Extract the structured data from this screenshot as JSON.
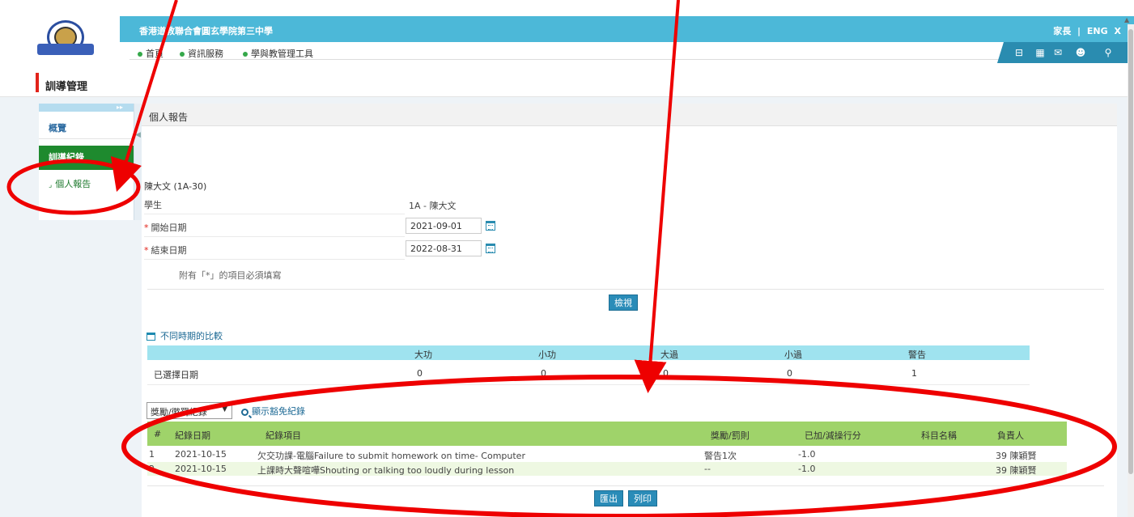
{
  "header": {
    "school_name": "香港道教聯合會圓玄學院第三中學",
    "user_role": "家長",
    "separator": "|",
    "lang_toggle": "ENG",
    "close_label": "X"
  },
  "nav": {
    "items": [
      {
        "label": "首頁"
      },
      {
        "label": "資訊服務"
      },
      {
        "label": "學與教管理工具"
      }
    ]
  },
  "toolbar_icons": [
    "eclass-icon",
    "calendar-icon",
    "mail-icon",
    "group-icon",
    "search-user-icon"
  ],
  "page": {
    "title": "訓導管理"
  },
  "sidebar": {
    "items": [
      {
        "label": "概覽"
      },
      {
        "label": "訓導紀錄"
      },
      {
        "label": "個人報告"
      }
    ]
  },
  "panel": {
    "title": "個人報告"
  },
  "form": {
    "student_heading": "陳大文 (1A-30)",
    "student_label": "學生",
    "student_value": "1A - 陳大文",
    "start_label": "開始日期",
    "start_value": "2021-09-01",
    "end_label": "結束日期",
    "end_value": "2022-08-31",
    "required_star": "*",
    "required_note": "附有「*」的項目必須填寫",
    "view_button": "檢視"
  },
  "comparison": {
    "title": "不同時期的比較",
    "columns": [
      "大功",
      "小功",
      "大過",
      "小過",
      "警告"
    ],
    "row_label": "已選擇日期",
    "values": [
      "0",
      "0",
      "0",
      "0",
      "1"
    ]
  },
  "records": {
    "filter_value": "獎勵/懲罰紀錄",
    "show_exempt": "顯示豁免紀錄",
    "columns": {
      "index": "#",
      "date": "紀錄日期",
      "item": "紀錄項目",
      "merit": "獎勵/罰則",
      "score": "已加/減操行分",
      "subject": "科目名稱",
      "teacher": "負責人"
    },
    "rows": [
      {
        "index": "1",
        "date": "2021-10-15",
        "item": "欠交功課-電腦Failure to submit homework on time- Computer",
        "merit": "警告1次",
        "score": "-1.0",
        "subject": "",
        "teacher": "39 陳穎賢"
      },
      {
        "index": "2",
        "date": "2021-10-15",
        "item": "上課時大聲喧嘩Shouting or talking too loudly during lesson",
        "merit": "--",
        "score": "-1.0",
        "subject": "",
        "teacher": "39 陳穎賢"
      }
    ],
    "export_button": "匯出",
    "print_button": "列印"
  },
  "colors": {
    "header_blue": "#4cb8d8",
    "sidebar_green": "#1e8a2e",
    "records_header_green": "#9fd36a",
    "comparison_header_cyan": "#9fe3ef",
    "button_blue": "#2a8cb8",
    "annotation_red": "#ee0000"
  }
}
